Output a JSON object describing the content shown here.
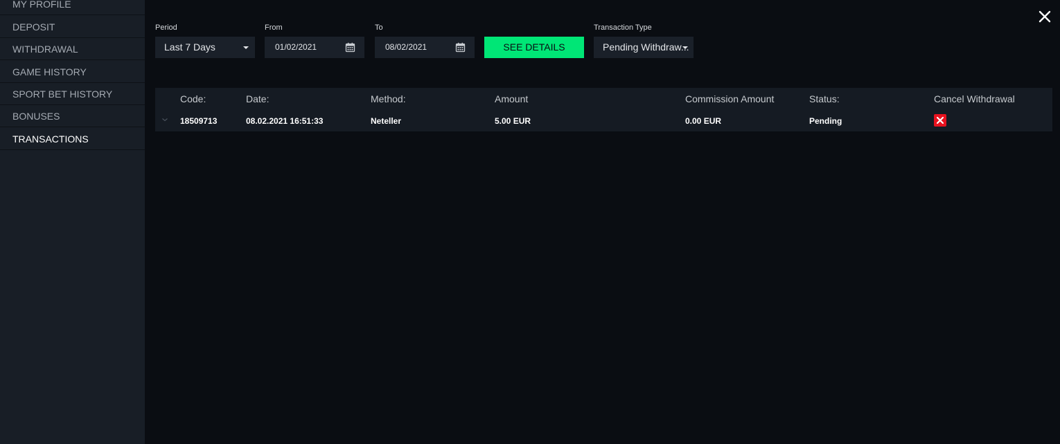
{
  "sidebar": {
    "items": [
      {
        "label": "MY PROFILE",
        "active": false
      },
      {
        "label": "DEPOSIT",
        "active": false
      },
      {
        "label": "WITHDRAWAL",
        "active": false
      },
      {
        "label": "GAME HISTORY",
        "active": false
      },
      {
        "label": "SPORT BET HISTORY",
        "active": false
      },
      {
        "label": "BONUSES",
        "active": false
      },
      {
        "label": "TRANSACTIONS",
        "active": true
      }
    ]
  },
  "filters": {
    "period": {
      "label": "Period",
      "value": "Last 7 Days"
    },
    "from": {
      "label": "From",
      "value": "01/02/2021"
    },
    "to": {
      "label": "To",
      "value": "08/02/2021"
    },
    "see_details_label": "SEE DETAILS",
    "transaction_type": {
      "label": "Transaction Type",
      "value": "Pending Withdraw..."
    }
  },
  "table": {
    "headers": {
      "code": "Code:",
      "date": "Date:",
      "method": "Method:",
      "amount": "Amount",
      "commission": "Commission Amount",
      "status": "Status:",
      "cancel": "Cancel Withdrawal"
    },
    "rows": [
      {
        "code": "18509713",
        "date": "08.02.2021 16:51:33",
        "method": "Neteller",
        "amount": "5.00 EUR",
        "commission": "0.00 EUR",
        "status": "Pending"
      }
    ]
  },
  "icons": {
    "close": "close-icon",
    "calendar": "calendar-icon",
    "caret": "caret-down-icon",
    "row_expand": "chevron-down-icon",
    "cancel": "cancel-x-icon"
  },
  "colors": {
    "accent": "#00e676",
    "danger": "#e8121f",
    "sidebar_bg": "#181e26",
    "main_bg": "#0a0d12"
  }
}
